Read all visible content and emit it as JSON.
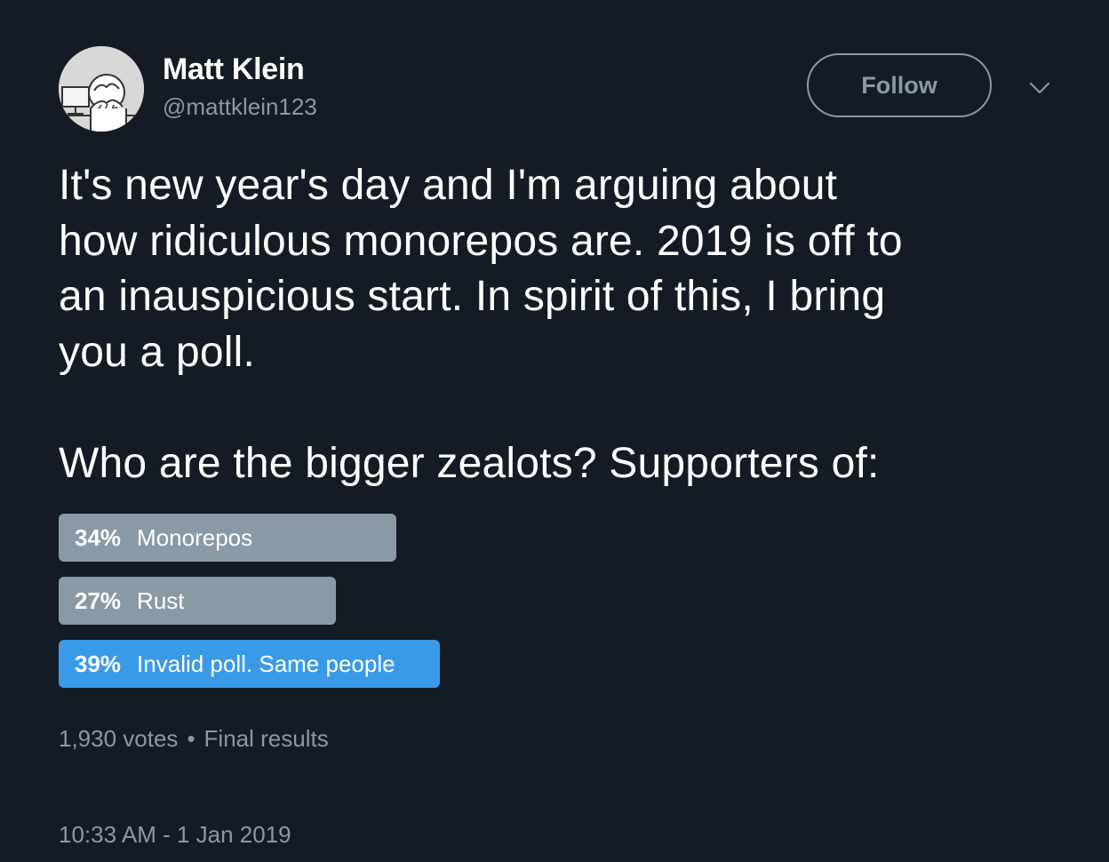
{
  "user": {
    "display_name": "Matt Klein",
    "handle": "@mattklein123"
  },
  "follow_label": "Follow",
  "tweet": {
    "text": "It's new year's day and I'm arguing about\nhow ridiculous monorepos are. 2019 is off to\nan inauspicious start. In spirit of this, I bring\nyou a poll.\n\nWho are the bigger zealots? Supporters of:"
  },
  "poll": {
    "options": [
      {
        "percent_label": "34%",
        "label": "Monorepos",
        "percent": 34,
        "winner": false
      },
      {
        "percent_label": "27%",
        "label": "Rust",
        "percent": 27,
        "winner": false
      },
      {
        "percent_label": "39%",
        "label": "Invalid poll. Same people",
        "percent": 39,
        "winner": true
      }
    ],
    "votes": "1,930 votes",
    "separator": "•",
    "status": "Final results"
  },
  "timestamp": "10:33 AM - 1 Jan 2019",
  "colors": {
    "background": "#151b24",
    "bar": "#8a99a6",
    "winner_bar": "#3a9ae8",
    "secondary_text": "#8899a6"
  },
  "icons": {
    "avatar": "cartoon-avatar",
    "more": "chevron-down-icon"
  }
}
